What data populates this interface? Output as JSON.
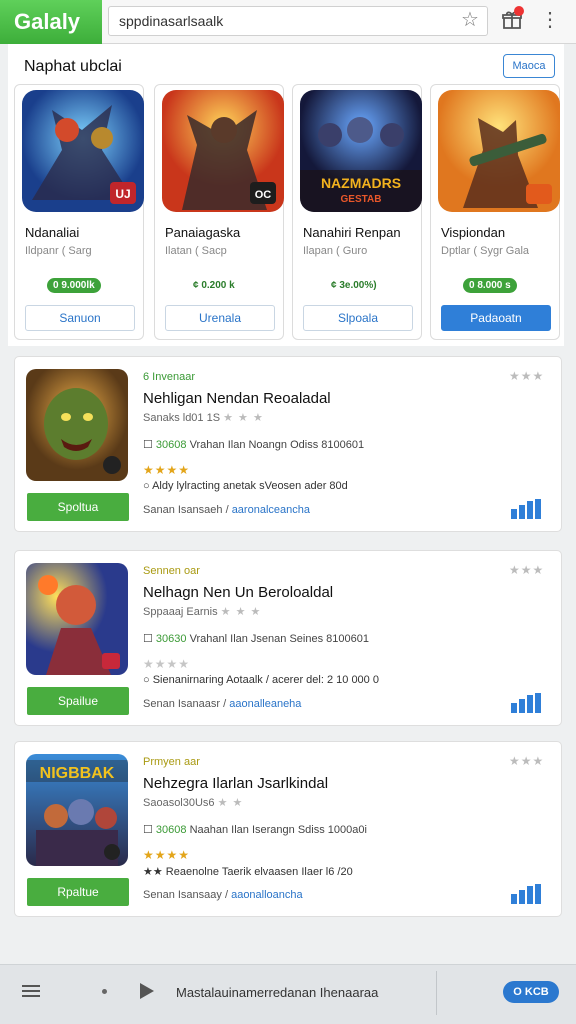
{
  "topbar": {
    "logo": "Galaly",
    "url": "sppdinasarlsaalk",
    "star_icon": "star-outline-icon",
    "gift_icon": "gift-icon",
    "more_icon": "vertical-dots-icon"
  },
  "featured": {
    "title": "Naphat ubclai",
    "more_label": "Maoca",
    "cards": [
      {
        "name": "Ndanaliai",
        "sub": "Ildpanr ( Sarg",
        "price": "0 9.000lk",
        "button": "Sanuon",
        "badge": "UJ"
      },
      {
        "name": "Panaiagaska",
        "sub": "Ilatan ( Sacp",
        "price": "¢ 0.200 k",
        "button": "Urenala",
        "badge": "OC"
      },
      {
        "name": "Nanahiri Renpan",
        "sub": "Ilapan ( Guro",
        "price": "¢ 3e.00%)",
        "button": "Slpoala",
        "art_text_1": "NAZMADRS",
        "art_text_2": "GESTAB"
      },
      {
        "name": "Vispiondan",
        "sub": "Dptlar ( Sygr Gala",
        "price": "0 8.000 s",
        "button": "Padaoatn"
      }
    ]
  },
  "list": [
    {
      "tag": "6 Invenaar",
      "title": "Nehligan Nendan Reoaladal",
      "meta": "Sanaks ld01 1S",
      "meta_stars": "★ ★ ★",
      "info_code": "30608",
      "info_text": "Vrahan Ilan Noangn Odiss 8100601",
      "rating": "★★★★",
      "desc": "Aldy lylracting anetak sVeosen ader 80d",
      "button": "Spoltua",
      "foot_text": "Sanan Isansaeh /",
      "foot_link": "aaronalceancha",
      "corner_stars": "★★★"
    },
    {
      "tag": "Sennen oar",
      "title": "Nelhagn Nen Un Beroloaldal",
      "meta": "Sppaaaj Earnis",
      "meta_stars": "★ ★ ★",
      "info_code": "30630",
      "info_text": "Vrahanl Ilan Jsenan Seines 8100601",
      "rating": "★★★★",
      "desc": "Sienanirnaring Aotaalk / acerer del: 2 10 000 0",
      "button": "Spailue",
      "foot_text": "Senan Isanaasr /",
      "foot_link": "aaonalleaneha",
      "corner_stars": "★★★"
    },
    {
      "tag": "Prmyen aar",
      "title": "Nehzegra Ilarlan Jsarlkindal",
      "meta": "Saoasol30Us6",
      "meta_stars": "★ ★",
      "info_code": "30608",
      "info_text": "Naahan Ilan Iserangn Sdiss 1000a0i",
      "rating": "★★★★",
      "desc": "★★ Reaenolne Taerik elvaasen Ilaer l6 /20",
      "button": "Rpaltue",
      "foot_text": "Senan Isansaay /",
      "foot_link": "aaonalloancha",
      "corner_stars": "★★★",
      "art_text": "NIGBBAK"
    }
  ],
  "bottombar": {
    "menu_icon": "hamburger-menu-icon",
    "dot_icon": "dot-icon",
    "play_icon": "play-icon",
    "now_playing": "Mastalauinamerredanan Ihenaaraa",
    "pill_label": "O KCB"
  },
  "colors": {
    "brand_green": "#49ad3f",
    "accent_blue": "#2f7fd8",
    "star_gold": "#e3a51a"
  }
}
